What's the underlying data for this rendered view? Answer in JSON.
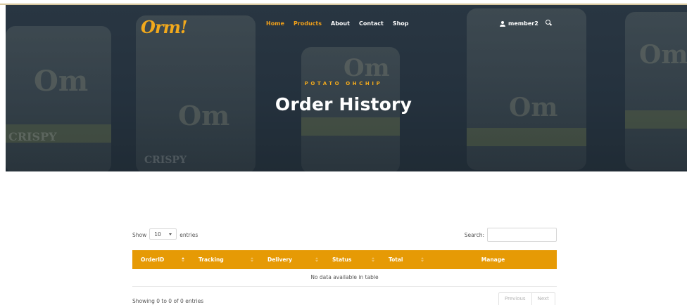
{
  "header": {
    "brand": "Orm!",
    "nav": [
      {
        "label": "Home",
        "active": true
      },
      {
        "label": "Products",
        "active": true
      },
      {
        "label": "About",
        "active": false
      },
      {
        "label": "Contact",
        "active": false
      },
      {
        "label": "Shop",
        "active": false
      }
    ],
    "user_label": "member2"
  },
  "hero": {
    "eyebrow": "POTATO OHCHIP",
    "title": "Order History"
  },
  "table_controls": {
    "show_label": "Show",
    "entries_value": "10",
    "entries_label": "entries",
    "search_label": "Search:"
  },
  "table": {
    "columns": [
      "OrderID",
      "Tracking",
      "Delivery",
      "Status",
      "Total",
      "Manage"
    ],
    "empty_message": "No data available in table"
  },
  "footer_info": "Showing 0 to 0 of 0 entries",
  "pagination": {
    "previous": "Previous",
    "next": "Next"
  },
  "colors": {
    "accent": "#e69a05",
    "brand": "#f2a91c",
    "hero_bg": "#263440"
  }
}
